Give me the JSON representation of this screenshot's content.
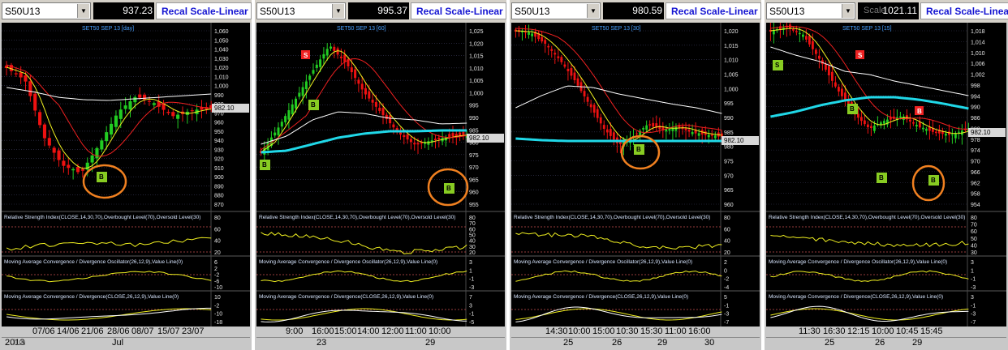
{
  "panels": [
    {
      "symbol": "S50U13",
      "price": "937.23",
      "scale_button": "Recal Scale-Linear",
      "chart_title": "SET50 SEP 13  [day]",
      "price_tag": "982.10",
      "price_ticks": [
        "1,060",
        "1,050",
        "1,040",
        "1,030",
        "1,020",
        "1,010",
        "1,000",
        "990",
        "980",
        "970",
        "960",
        "950",
        "940",
        "930",
        "920",
        "910",
        "900",
        "890",
        "880",
        "870"
      ],
      "markers": [
        {
          "type": "buy",
          "label": "B"
        }
      ],
      "rsi_title": "Relative Strength Index(CLOSE,14,30,70),Overbought Level(70),Oversold Level(30)",
      "rsi_ticks": [
        "80",
        "60",
        "40",
        "20"
      ],
      "macd1_title": "Moving Average Convergence / Divergence Oscillator(26,12,9),Value Line(0)",
      "macd1_ticks": [
        "6",
        "2",
        "-2",
        "-6",
        "-10"
      ],
      "macd2_title": "Moving Average Convergence / Divergence(CLOSE,26,12,9),Value Line(0)",
      "macd2_ticks": [
        "10",
        "-2",
        "-10",
        "-18"
      ],
      "x_top": [
        "07/06",
        "14/06",
        "21/06",
        "28/06",
        "08/07",
        "15/07",
        "23/07"
      ],
      "x_bottom": [
        "2013",
        "Jul"
      ],
      "x_bottom_overlay": "Jun"
    },
    {
      "symbol": "S50U13",
      "price": "995.37",
      "scale_button": "Recal Scale-Linear",
      "chart_title": "SET50 SEP 13  [60]",
      "price_tag": "982.10",
      "price_ticks": [
        "1,025",
        "1,020",
        "1,015",
        "1,010",
        "1,005",
        "1,000",
        "995",
        "990",
        "985",
        "980",
        "975",
        "970",
        "965",
        "960",
        "955"
      ],
      "markers": [
        {
          "type": "sell",
          "label": "S"
        },
        {
          "type": "buy",
          "label": "B"
        },
        {
          "type": "buy",
          "label": "B"
        },
        {
          "type": "buy",
          "label": "B"
        }
      ],
      "rsi_title": "Relative Strength Index(CLOSE,14,30,70),Overbought Level(70),Oversold Level(30)",
      "rsi_ticks": [
        "80",
        "70",
        "60",
        "50",
        "40",
        "30",
        "20"
      ],
      "macd1_title": "Moving Average Convergence / Divergence Oscillator(26,12,9),Value Line(0)",
      "macd1_ticks": [
        "3",
        "1",
        "-1",
        "-3"
      ],
      "macd2_title": "Moving Average Convergence / Divergence(CLOSE,26,12,9),Value Line(0)",
      "macd2_ticks": [
        "7",
        "3",
        "-1",
        "-5"
      ],
      "x_top": [
        "9:00",
        "16:00",
        "15:00",
        "14:00",
        "12:00",
        "11:00",
        "10:00"
      ],
      "x_bottom": [
        "23",
        "29"
      ]
    },
    {
      "symbol": "S50U13",
      "price": "980.59",
      "scale_button": "Recal Scale-Linear",
      "chart_title": "SET50 SEP 13  [30]",
      "price_tag": "982.10",
      "price_ticks": [
        "1,020",
        "1,015",
        "1,010",
        "1,005",
        "1,000",
        "995",
        "990",
        "985",
        "980",
        "975",
        "970",
        "965",
        "960"
      ],
      "markers": [
        {
          "type": "buy",
          "label": "B"
        }
      ],
      "rsi_title": "Relative Strength Index(CLOSE,14,30,70),Overbought Level(70),Oversold Level(30)",
      "rsi_ticks": [
        "80",
        "60",
        "40",
        "20"
      ],
      "macd1_title": "Moving Average Convergence / Divergence Oscillator(26,12,9),Value Line(0)",
      "macd1_ticks": [
        "2",
        "0",
        "-2",
        "-4"
      ],
      "macd2_title": "Moving Average Convergence / Divergence(CLOSE,26,12,9),Value Line(0)",
      "macd2_ticks": [
        "5",
        "-1",
        "-3",
        "-7"
      ],
      "x_top": [
        "14:30",
        "10:00",
        "15:00",
        "10:30",
        "15:30",
        "11:00",
        "16:00"
      ],
      "x_bottom": [
        "25",
        "26",
        "29",
        "30"
      ]
    },
    {
      "symbol": "S50U13",
      "price": "1021.11",
      "scale_button": "Recal Scale-Linear",
      "scale_overlay": "Scale",
      "chart_title": "SET50 SEP 13  [15]",
      "price_tag": "982.10",
      "price_ticks": [
        "1,018",
        "1,014",
        "1,010",
        "1,006",
        "1,002",
        "998",
        "994",
        "990",
        "986",
        "982",
        "978",
        "974",
        "970",
        "966",
        "962",
        "958",
        "954"
      ],
      "markers": [
        {
          "type": "sell",
          "label": "S"
        },
        {
          "type": "sell",
          "label": "S"
        },
        {
          "type": "buy",
          "label": "B"
        },
        {
          "type": "buy",
          "label": "B"
        },
        {
          "type": "buy",
          "label": "B"
        },
        {
          "type": "buy",
          "label": "B"
        }
      ],
      "rsi_title": "Relative Strength Index(CLOSE,14,30,70),Overbought Level(70),Oversold Level(30)",
      "rsi_ticks": [
        "80",
        "70",
        "60",
        "50",
        "40",
        "30"
      ],
      "macd1_title": "Moving Average Convergence / Divergence Oscillator(26,12,9),Value Line(0)",
      "macd1_ticks": [
        "3",
        "1",
        "-1",
        "-3"
      ],
      "macd2_title": "Moving Average Convergence / Divergence(CLOSE,26,12,9),Value Line(0)",
      "macd2_ticks": [
        "3",
        "-1",
        "-3",
        "-7"
      ],
      "x_top": [
        "11:30",
        "16:30",
        "12:15",
        "10:00",
        "10:45",
        "15:45"
      ],
      "x_bottom": [
        "25",
        "26",
        "29"
      ]
    }
  ],
  "colors": {
    "chart_bg": "#000000",
    "candle_up": "#22cc22",
    "candle_down": "#ee1111",
    "ma_long": "#20d8e8",
    "ma_mid": "#ffffff",
    "ma_red": "#ee2020",
    "ma_yellow": "#f0f020",
    "buy_marker": "#88cc22",
    "sell_marker": "#ee2222",
    "highlight_circle": "#f08020",
    "tag_bg": "#d8d8d8",
    "title_blue": "#1414d2"
  }
}
